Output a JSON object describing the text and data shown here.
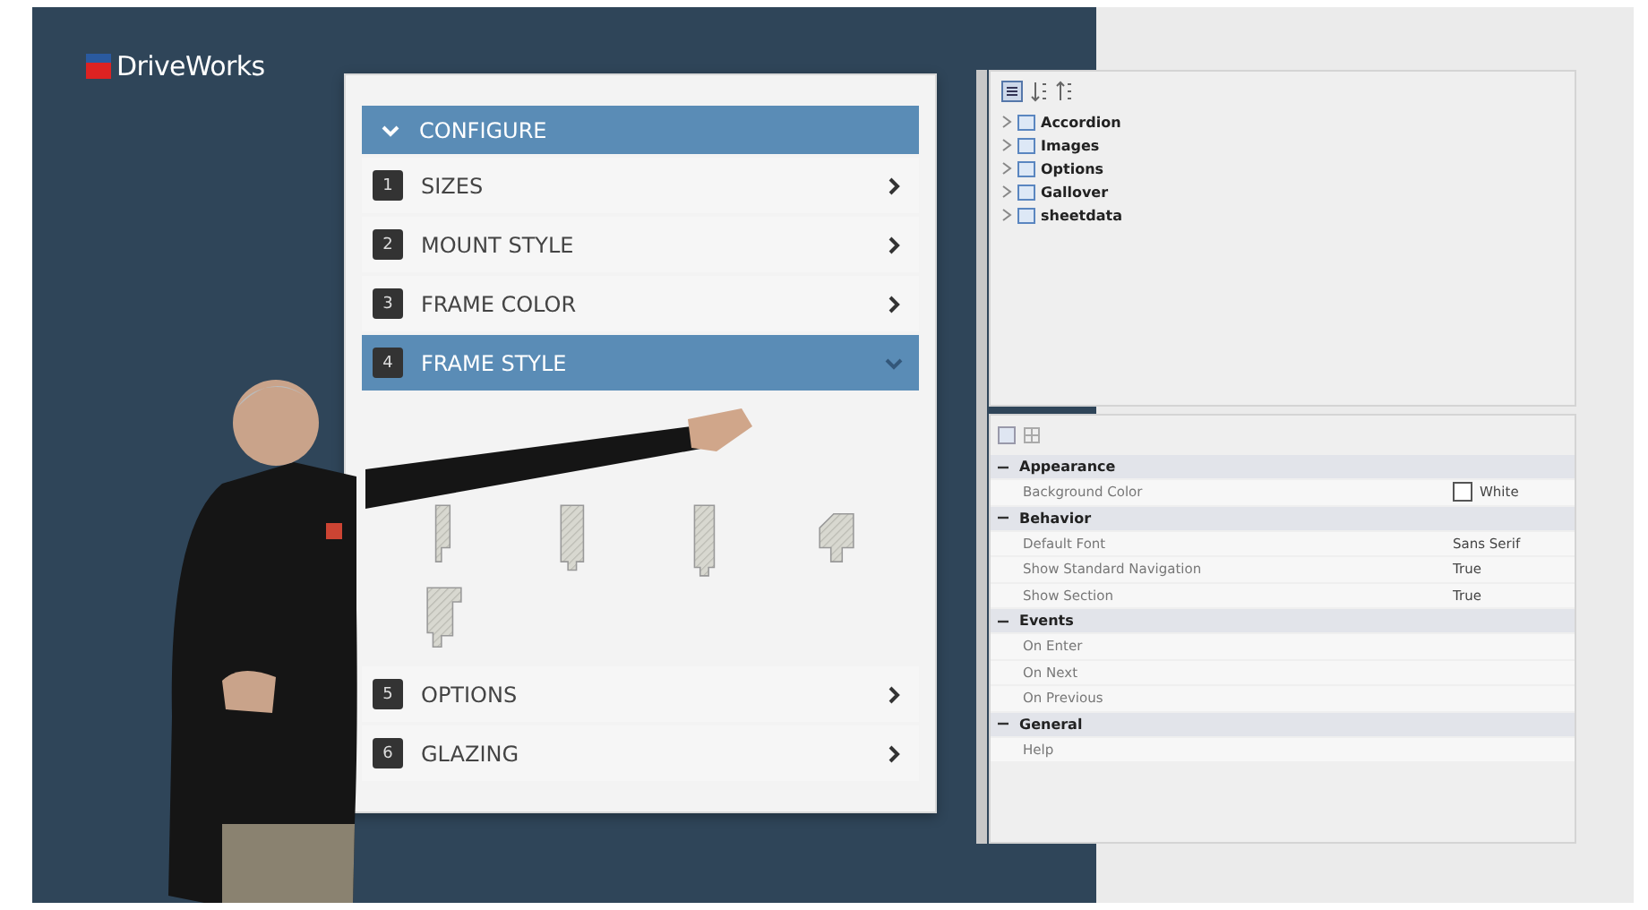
{
  "logo": {
    "text": "DriveWorks"
  },
  "configurator": {
    "header": {
      "label": "CONFIGURE",
      "expanded": true
    },
    "steps": [
      {
        "number": "1",
        "label": "SIZES",
        "expanded": false
      },
      {
        "number": "2",
        "label": "MOUNT STYLE",
        "expanded": false
      },
      {
        "number": "3",
        "label": "FRAME COLOR",
        "expanded": false
      },
      {
        "number": "4",
        "label": "FRAME STYLE",
        "expanded": true
      },
      {
        "number": "5",
        "label": "OPTIONS",
        "expanded": false
      },
      {
        "number": "6",
        "label": "GLAZING",
        "expanded": false
      }
    ]
  },
  "explorer": {
    "tree": [
      {
        "name": "Accordion",
        "expanded": false
      },
      {
        "name": "Images",
        "expanded": false
      },
      {
        "name": "Options",
        "expanded": false
      },
      {
        "name": "Gallover",
        "expanded": false
      },
      {
        "name": "sheetdata",
        "expanded": false
      }
    ]
  },
  "properties": {
    "categories": [
      {
        "name": "Appearance",
        "expanded": true,
        "rows": [
          {
            "name": "Background Color",
            "value": "White",
            "kind": "color"
          }
        ]
      },
      {
        "name": "Behavior",
        "expanded": true,
        "rows": [
          {
            "name": "Default Font",
            "value": "Sans Serif",
            "kind": "text"
          },
          {
            "name": "Show Standard Navigation",
            "value": "True",
            "kind": "text"
          },
          {
            "name": "Show Section",
            "value": "True",
            "kind": "text"
          }
        ]
      },
      {
        "name": "Events",
        "expanded": true,
        "rows": [
          {
            "name": "On Enter"
          },
          {
            "name": "On Next"
          },
          {
            "name": "On Previous"
          }
        ]
      },
      {
        "name": "General",
        "expanded": true,
        "rows": [
          {
            "name": "Help"
          }
        ]
      }
    ]
  }
}
